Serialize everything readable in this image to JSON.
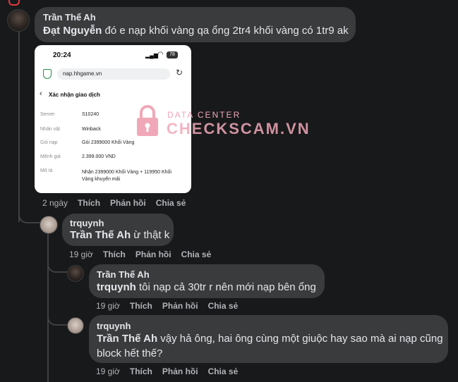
{
  "comments": [
    {
      "author": "Trần Thế Ah",
      "mention": "Đạt Nguyễn",
      "text": " đó e nạp khối vàng qa ổng 2tr4 khối vàng có 1tr9 ak",
      "actions": {
        "time": "2 ngày",
        "like": "Thích",
        "reply": "Phản hồi",
        "share": "Chia sẻ"
      }
    },
    {
      "author": "trquynh",
      "mention": "Trần Thế Ah",
      "text": " ừ thật k",
      "actions": {
        "time": "19 giờ",
        "like": "Thích",
        "reply": "Phản hồi",
        "share": "Chia sẻ"
      }
    },
    {
      "author": "Trần Thế Ah",
      "mention": "trquynh",
      "text": " tôi nạp cả 30tr r nên mới nạp bên ổng",
      "actions": {
        "time": "19 giờ",
        "like": "Thích",
        "reply": "Phản hồi",
        "share": "Chia sẻ"
      }
    },
    {
      "author": "trquynh",
      "mention": "Trần Thế Ah",
      "text_line1": " vậy hả ông, hai ông cùng một giuộc hay sao mà ai nạp cũng",
      "text_line2": "block hết thế?",
      "actions": {
        "time": "19 giờ",
        "like": "Thích",
        "reply": "Phản hồi",
        "share": "Chia sẻ"
      }
    }
  ],
  "attachment": {
    "clock": "20:24",
    "battery": "78",
    "url": "nap.hhgame.vn",
    "page_title": "Xác nhận giao dịch",
    "rows": [
      {
        "label": "Server",
        "value": "S10240"
      },
      {
        "label": "Nhân vật",
        "value": "Winback"
      },
      {
        "label": "Gói nạp",
        "value": "Gói 2399000 Khối Vàng"
      },
      {
        "label": "Mệnh giá",
        "value": "2.399.000 VND"
      },
      {
        "label": "Mô tả",
        "value": "Nhận 2399000 Khối Vàng + 119950 Khối",
        "value2": "Vàng khuyến mãi"
      }
    ]
  },
  "watermark": {
    "line1": "DATA CENTER",
    "line2": "CHECKSCAM.VN",
    "color": "#f0a8b8"
  },
  "colors": {
    "background": "#18191a",
    "bubble": "#3a3b3c",
    "text": "#e4e6eb",
    "muted": "#b0b3b8"
  }
}
